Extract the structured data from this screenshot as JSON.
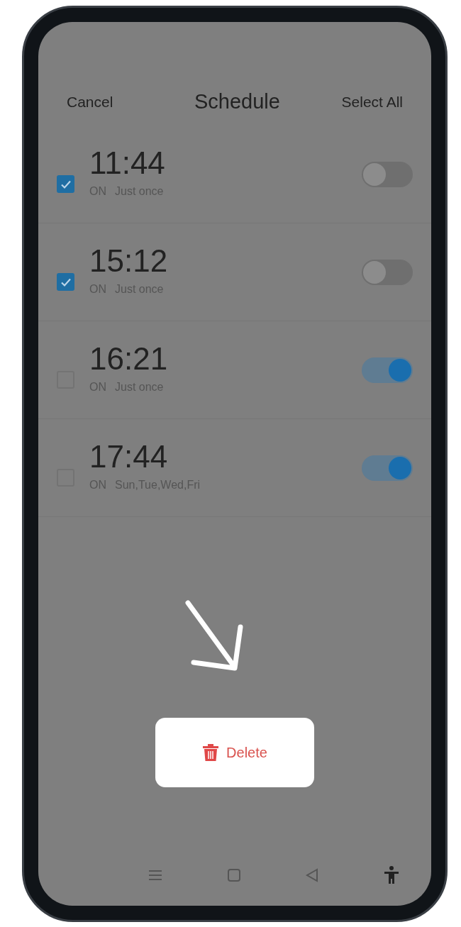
{
  "header": {
    "cancel": "Cancel",
    "title": "Schedule",
    "select_all": "Select All"
  },
  "alarms": [
    {
      "time": "11:44",
      "status": "ON",
      "repeat": "Just once",
      "checked": true,
      "on": false
    },
    {
      "time": "15:12",
      "status": "ON",
      "repeat": "Just once",
      "checked": true,
      "on": false
    },
    {
      "time": "16:21",
      "status": "ON",
      "repeat": "Just once",
      "checked": false,
      "on": true
    },
    {
      "time": "17:44",
      "status": "ON",
      "repeat": "Sun,Tue,Wed,Fri",
      "checked": false,
      "on": true
    }
  ],
  "delete_button": {
    "label": "Delete"
  }
}
